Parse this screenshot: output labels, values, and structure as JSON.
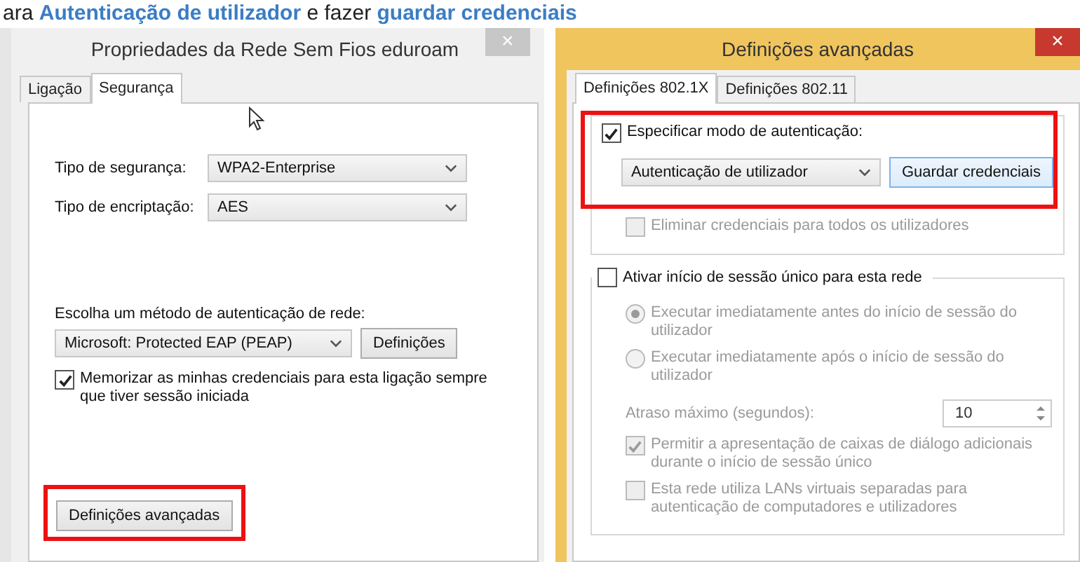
{
  "caption": "ara **Autenticação de utilizador** e fazer **guardar credenciais**",
  "left_window": {
    "title": "Propriedades da Rede Sem Fios eduroam",
    "close": "×",
    "tabs": [
      {
        "label": "Ligação",
        "selected": false
      },
      {
        "label": "Segurança",
        "selected": true
      }
    ],
    "security_type": {
      "label": "Tipo de segurança:",
      "value": "WPA2-Enterprise"
    },
    "encryption_type": {
      "label": "Tipo de encriptação:",
      "value": "AES"
    },
    "auth_method": {
      "label": "Escolha um método de autenticação de rede:",
      "value": "Microsoft: Protected EAP (PEAP)",
      "button": "Definições"
    },
    "remember": {
      "label": "Memorizar as minhas credenciais para esta ligação sempre que tiver sessão iniciada",
      "checked": true
    },
    "advanced_button": {
      "label": "Definições avançadas",
      "highlighted": true
    }
  },
  "right_window": {
    "title": "Definições avançadas",
    "close": "×",
    "tabs": [
      {
        "label": "Definições 802.1X",
        "selected": true
      },
      {
        "label": "Definições 802.11",
        "selected": false
      }
    ],
    "auth_group": {
      "highlighted": true,
      "checkbox": {
        "label": "Especificar modo de autenticação:",
        "checked": true
      },
      "mode": "Autenticação de utilizador",
      "save_button": "Guardar credenciais",
      "delete_all": {
        "label": "Eliminar credenciais para todos os utilizadores",
        "checked": false,
        "disabled": true
      }
    },
    "sso_group": {
      "checkbox": {
        "label": "Ativar início de sessão único para esta rede",
        "checked": false
      },
      "options": [
        {
          "kind": "radio",
          "label": "Executar imediatamente antes do início de sessão do utilizador",
          "selected": true,
          "disabled": true
        },
        {
          "kind": "radio",
          "label": "Executar imediatamente após o início de sessão do utilizador",
          "selected": false,
          "disabled": true
        },
        {
          "kind": "spinner",
          "label": "Atraso máximo (segundos):",
          "value": "10",
          "disabled": true
        },
        {
          "kind": "checkbox",
          "label": "Permitir a apresentação de caixas de diálogo adicionais durante o início de sessão único",
          "checked": true,
          "disabled": true
        },
        {
          "kind": "checkbox",
          "label": "Esta rede utiliza LANs virtuais separadas para autenticação de computadores e utilizadores",
          "checked": false,
          "disabled": true
        }
      ]
    }
  }
}
